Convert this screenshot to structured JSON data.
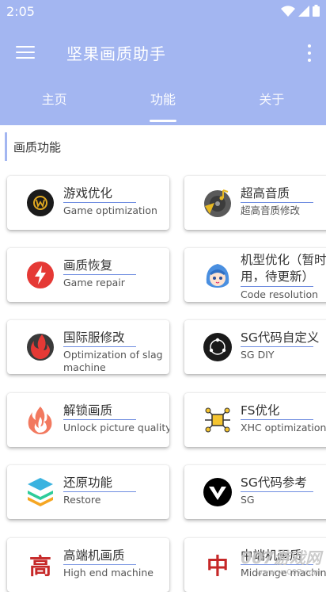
{
  "status": {
    "time": "2:05"
  },
  "app": {
    "title": "坚果画质助手"
  },
  "tabs": [
    {
      "label": "主页"
    },
    {
      "label": "功能"
    },
    {
      "label": "关于"
    }
  ],
  "section": {
    "title": "画质功能"
  },
  "cards": [
    {
      "title": "游戏优化",
      "subtitle": "Game optimization",
      "icon": "game-w-logo-icon"
    },
    {
      "title": "超高音质",
      "subtitle": "超高音质修改",
      "icon": "music-disc-icon"
    },
    {
      "title": "画质恢复",
      "subtitle": "Game repair",
      "icon": "lightning-icon"
    },
    {
      "title": "机型优化（暂时用，待更新）",
      "subtitle": "Code resolution",
      "icon": "anime-character-icon"
    },
    {
      "title": "国际服修改",
      "subtitle": "Optimization of slag machine",
      "icon": "fire-circle-icon"
    },
    {
      "title": "SG代码自定义",
      "subtitle": "SG DIY",
      "icon": "orbit-dots-icon"
    },
    {
      "title": "解锁画质",
      "subtitle": "Unlock picture quality",
      "icon": "flame-icon"
    },
    {
      "title": "FS优化",
      "subtitle": "XHC optimization",
      "icon": "network-nodes-icon"
    },
    {
      "title": "还原功能",
      "subtitle": "Restore",
      "icon": "layers-stack-icon"
    },
    {
      "title": "SG代码参考",
      "subtitle": "SG",
      "icon": "v-logo-icon"
    },
    {
      "title": "高端机画质",
      "subtitle": "High end machine",
      "icon": "gao-character-icon",
      "glyph": "高"
    },
    {
      "title": "中端机画质",
      "subtitle": "Midrange machine",
      "icon": "zhong-character-icon",
      "glyph": "中"
    }
  ],
  "watermark": {
    "main": "007游戏网",
    "sub": "www.yx007.com"
  },
  "colors": {
    "appbar": "#a3b6f1",
    "accent_rule": "#6f8de0"
  }
}
